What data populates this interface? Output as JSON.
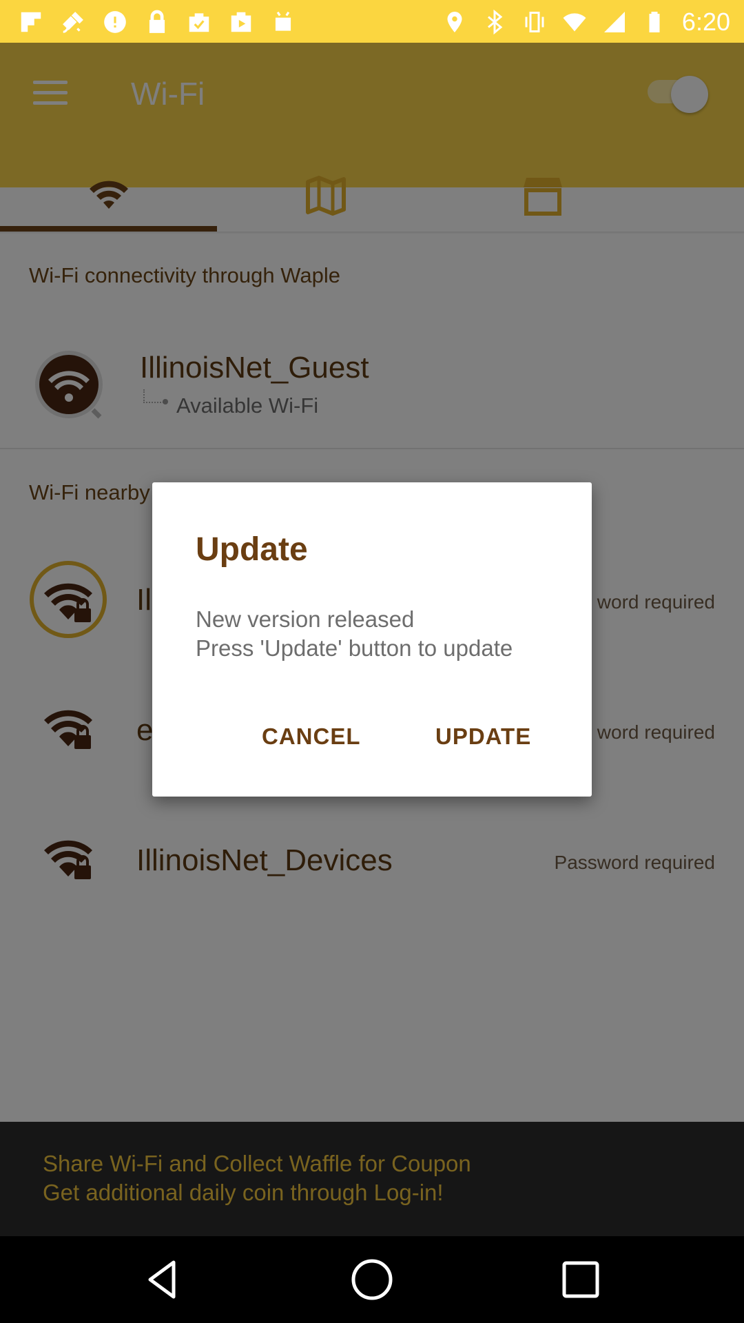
{
  "status_bar": {
    "time": "6:20"
  },
  "app_bar": {
    "title": "Wi-Fi",
    "tabs": [
      "wifi-icon",
      "map-icon",
      "store-icon"
    ],
    "toggle_on": true
  },
  "connectivity": {
    "header": "Wi-Fi connectivity through Waple",
    "network": {
      "name": "IllinoisNet_Guest",
      "status": "Available Wi-Fi"
    }
  },
  "nearby": {
    "header": "Wi-Fi nearby",
    "networks": [
      {
        "name": "Il",
        "status": "word required"
      },
      {
        "name": "e",
        "status": "word required"
      },
      {
        "name": "IllinoisNet_Devices",
        "status": "Password required"
      }
    ]
  },
  "banner": {
    "line1": "Share Wi-Fi and Collect Waffle for Coupon",
    "line2": "Get additional daily coin through Log-in!"
  },
  "dialog": {
    "title": "Update",
    "message_line1": "New version released",
    "message_line2": "Press 'Update' button to update",
    "cancel_label": "CANCEL",
    "update_label": "UPDATE"
  },
  "colors": {
    "accent": "#f9d34a",
    "brand_brown": "#6a3e12",
    "banner_bg": "#2d2d2d"
  }
}
